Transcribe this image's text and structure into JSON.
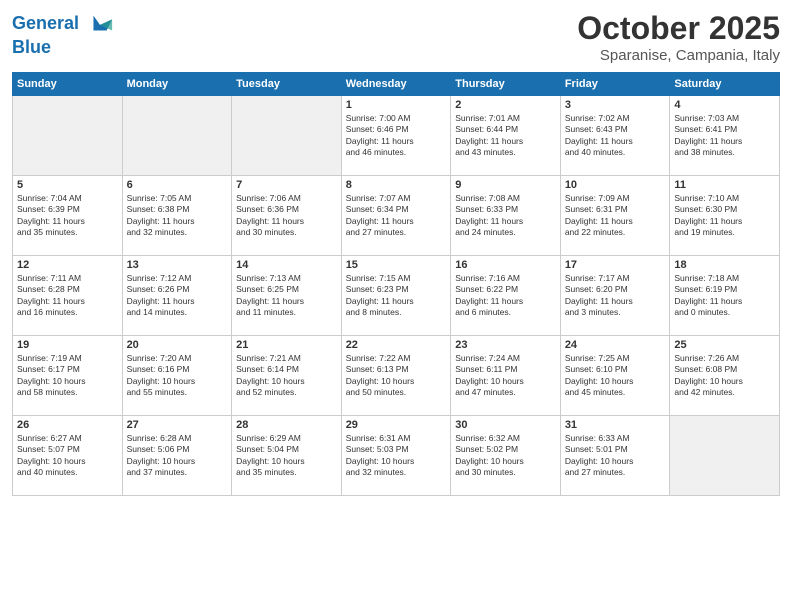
{
  "header": {
    "logo_line1": "General",
    "logo_line2": "Blue",
    "month": "October 2025",
    "location": "Sparanise, Campania, Italy"
  },
  "weekdays": [
    "Sunday",
    "Monday",
    "Tuesday",
    "Wednesday",
    "Thursday",
    "Friday",
    "Saturday"
  ],
  "weeks": [
    [
      {
        "day": "",
        "info": ""
      },
      {
        "day": "",
        "info": ""
      },
      {
        "day": "",
        "info": ""
      },
      {
        "day": "1",
        "info": "Sunrise: 7:00 AM\nSunset: 6:46 PM\nDaylight: 11 hours\nand 46 minutes."
      },
      {
        "day": "2",
        "info": "Sunrise: 7:01 AM\nSunset: 6:44 PM\nDaylight: 11 hours\nand 43 minutes."
      },
      {
        "day": "3",
        "info": "Sunrise: 7:02 AM\nSunset: 6:43 PM\nDaylight: 11 hours\nand 40 minutes."
      },
      {
        "day": "4",
        "info": "Sunrise: 7:03 AM\nSunset: 6:41 PM\nDaylight: 11 hours\nand 38 minutes."
      }
    ],
    [
      {
        "day": "5",
        "info": "Sunrise: 7:04 AM\nSunset: 6:39 PM\nDaylight: 11 hours\nand 35 minutes."
      },
      {
        "day": "6",
        "info": "Sunrise: 7:05 AM\nSunset: 6:38 PM\nDaylight: 11 hours\nand 32 minutes."
      },
      {
        "day": "7",
        "info": "Sunrise: 7:06 AM\nSunset: 6:36 PM\nDaylight: 11 hours\nand 30 minutes."
      },
      {
        "day": "8",
        "info": "Sunrise: 7:07 AM\nSunset: 6:34 PM\nDaylight: 11 hours\nand 27 minutes."
      },
      {
        "day": "9",
        "info": "Sunrise: 7:08 AM\nSunset: 6:33 PM\nDaylight: 11 hours\nand 24 minutes."
      },
      {
        "day": "10",
        "info": "Sunrise: 7:09 AM\nSunset: 6:31 PM\nDaylight: 11 hours\nand 22 minutes."
      },
      {
        "day": "11",
        "info": "Sunrise: 7:10 AM\nSunset: 6:30 PM\nDaylight: 11 hours\nand 19 minutes."
      }
    ],
    [
      {
        "day": "12",
        "info": "Sunrise: 7:11 AM\nSunset: 6:28 PM\nDaylight: 11 hours\nand 16 minutes."
      },
      {
        "day": "13",
        "info": "Sunrise: 7:12 AM\nSunset: 6:26 PM\nDaylight: 11 hours\nand 14 minutes."
      },
      {
        "day": "14",
        "info": "Sunrise: 7:13 AM\nSunset: 6:25 PM\nDaylight: 11 hours\nand 11 minutes."
      },
      {
        "day": "15",
        "info": "Sunrise: 7:15 AM\nSunset: 6:23 PM\nDaylight: 11 hours\nand 8 minutes."
      },
      {
        "day": "16",
        "info": "Sunrise: 7:16 AM\nSunset: 6:22 PM\nDaylight: 11 hours\nand 6 minutes."
      },
      {
        "day": "17",
        "info": "Sunrise: 7:17 AM\nSunset: 6:20 PM\nDaylight: 11 hours\nand 3 minutes."
      },
      {
        "day": "18",
        "info": "Sunrise: 7:18 AM\nSunset: 6:19 PM\nDaylight: 11 hours\nand 0 minutes."
      }
    ],
    [
      {
        "day": "19",
        "info": "Sunrise: 7:19 AM\nSunset: 6:17 PM\nDaylight: 10 hours\nand 58 minutes."
      },
      {
        "day": "20",
        "info": "Sunrise: 7:20 AM\nSunset: 6:16 PM\nDaylight: 10 hours\nand 55 minutes."
      },
      {
        "day": "21",
        "info": "Sunrise: 7:21 AM\nSunset: 6:14 PM\nDaylight: 10 hours\nand 52 minutes."
      },
      {
        "day": "22",
        "info": "Sunrise: 7:22 AM\nSunset: 6:13 PM\nDaylight: 10 hours\nand 50 minutes."
      },
      {
        "day": "23",
        "info": "Sunrise: 7:24 AM\nSunset: 6:11 PM\nDaylight: 10 hours\nand 47 minutes."
      },
      {
        "day": "24",
        "info": "Sunrise: 7:25 AM\nSunset: 6:10 PM\nDaylight: 10 hours\nand 45 minutes."
      },
      {
        "day": "25",
        "info": "Sunrise: 7:26 AM\nSunset: 6:08 PM\nDaylight: 10 hours\nand 42 minutes."
      }
    ],
    [
      {
        "day": "26",
        "info": "Sunrise: 6:27 AM\nSunset: 5:07 PM\nDaylight: 10 hours\nand 40 minutes."
      },
      {
        "day": "27",
        "info": "Sunrise: 6:28 AM\nSunset: 5:06 PM\nDaylight: 10 hours\nand 37 minutes."
      },
      {
        "day": "28",
        "info": "Sunrise: 6:29 AM\nSunset: 5:04 PM\nDaylight: 10 hours\nand 35 minutes."
      },
      {
        "day": "29",
        "info": "Sunrise: 6:31 AM\nSunset: 5:03 PM\nDaylight: 10 hours\nand 32 minutes."
      },
      {
        "day": "30",
        "info": "Sunrise: 6:32 AM\nSunset: 5:02 PM\nDaylight: 10 hours\nand 30 minutes."
      },
      {
        "day": "31",
        "info": "Sunrise: 6:33 AM\nSunset: 5:01 PM\nDaylight: 10 hours\nand 27 minutes."
      },
      {
        "day": "",
        "info": ""
      }
    ]
  ]
}
